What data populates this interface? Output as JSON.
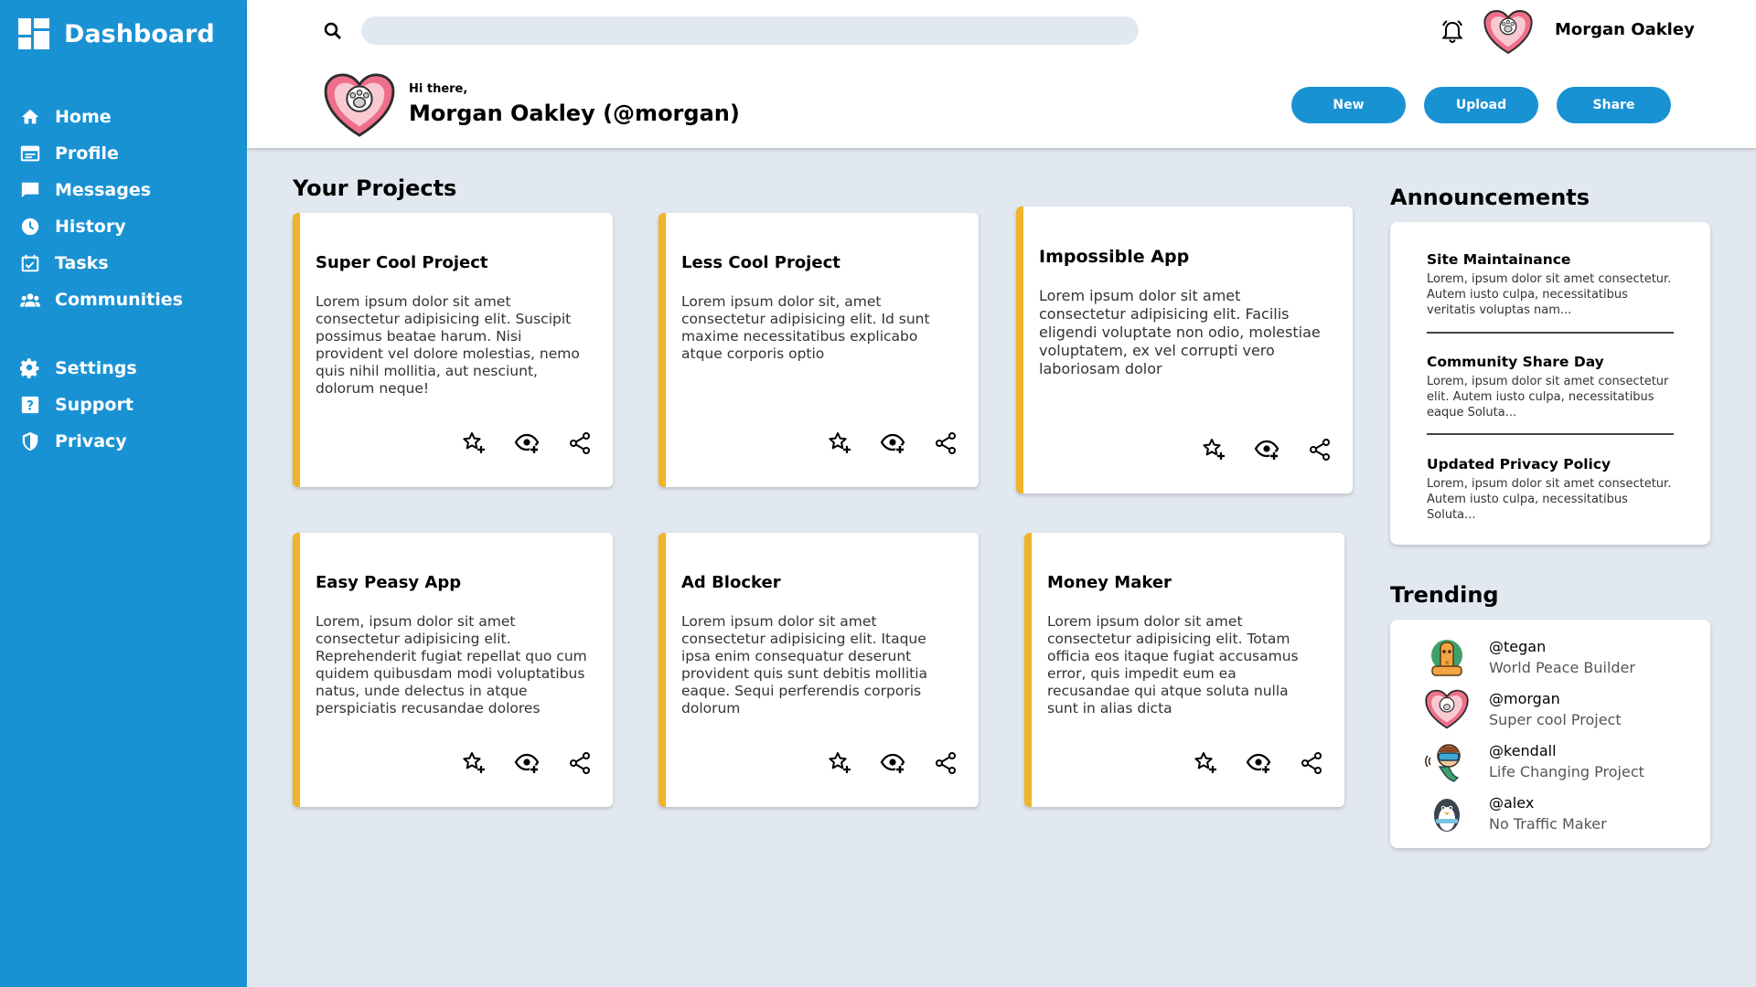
{
  "sidebar": {
    "brand": "Dashboard",
    "items": [
      {
        "label": "Home",
        "icon": "home-icon"
      },
      {
        "label": "Profile",
        "icon": "profile-icon"
      },
      {
        "label": "Messages",
        "icon": "messages-icon"
      },
      {
        "label": "History",
        "icon": "history-icon"
      },
      {
        "label": "Tasks",
        "icon": "tasks-icon"
      },
      {
        "label": "Communities",
        "icon": "communities-icon"
      }
    ],
    "items2": [
      {
        "label": "Settings",
        "icon": "settings-icon"
      },
      {
        "label": "Support",
        "icon": "support-icon"
      },
      {
        "label": "Privacy",
        "icon": "privacy-icon"
      }
    ]
  },
  "header": {
    "search": {
      "placeholder": "",
      "value": ""
    },
    "user_name": "Morgan Oakley",
    "greeting": "Hi there,",
    "greeting_name": "Morgan Oakley (@morgan)",
    "buttons": {
      "new": "New",
      "upload": "Upload",
      "share": "Share"
    }
  },
  "projects": {
    "title": "Your Projects",
    "cards": [
      {
        "title": "Super Cool Project",
        "desc": "Lorem ipsum dolor sit amet consectetur adipisicing elit. Suscipit possimus beatae harum. Nisi provident vel dolore molestias, nemo quis nihil mollitia, aut nesciunt, dolorum neque!"
      },
      {
        "title": "Less Cool Project",
        "desc": "Lorem ipsum dolor sit, amet consectetur adipisicing elit. Id sunt maxime necessitatibus explicabo atque corporis optio"
      },
      {
        "title": "Impossible App",
        "desc": "Lorem ipsum dolor sit amet consectetur adipisicing elit. Facilis eligendi voluptate non odio, molestiae voluptatem, ex vel corrupti vero laboriosam dolor"
      },
      {
        "title": "Easy Peasy App",
        "desc": "Lorem, ipsum dolor sit amet consectetur adipisicing elit. Reprehenderit fugiat repellat quo cum quidem quibusdam modi voluptatibus natus, unde delectus in atque perspiciatis recusandae dolores"
      },
      {
        "title": "Ad Blocker",
        "desc": "Lorem ipsum dolor sit amet consectetur adipisicing elit. Itaque ipsa enim consequatur deserunt provident quis sunt debitis mollitia eaque. Sequi perferendis corporis dolorum"
      },
      {
        "title": "Money Maker",
        "desc": "Lorem ipsum dolor sit amet consectetur adipisicing elit. Totam officia eos itaque fugiat accusamus error, quis impedit eum ea recusandae qui atque soluta nulla sunt in alias dicta"
      }
    ]
  },
  "announcements": {
    "title": "Announcements",
    "items": [
      {
        "title": "Site Maintainance",
        "text": "Lorem, ipsum dolor sit amet consectetur. Autem iusto culpa, necessitatibus veritatis voluptas nam..."
      },
      {
        "title": "Community Share Day",
        "text": "Lorem, ipsum dolor sit amet consectetur elit. Autem iusto culpa, necessitatibus eaque Soluta..."
      },
      {
        "title": "Updated Privacy Policy",
        "text": "Lorem, ipsum dolor sit amet consectetur. Autem iusto culpa, necessitatibus Soluta..."
      }
    ]
  },
  "trending": {
    "title": "Trending",
    "items": [
      {
        "handle": "@tegan",
        "project": "World Peace Builder"
      },
      {
        "handle": "@morgan",
        "project": "Super cool Project"
      },
      {
        "handle": "@kendall",
        "project": "Life Changing Project"
      },
      {
        "handle": "@alex",
        "project": "No Traffic Maker"
      }
    ]
  },
  "colors": {
    "accent": "#1992d4",
    "card_border": "#f0b429",
    "background": "#e2e8f0"
  }
}
